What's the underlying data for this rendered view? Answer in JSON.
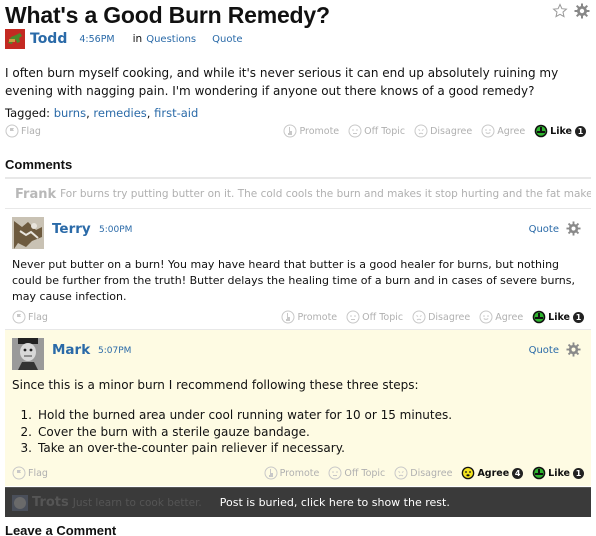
{
  "question": {
    "title": "What's a Good Burn Remedy?",
    "author": "Todd",
    "time": "4:56PM",
    "in_label": "in",
    "category": "Questions",
    "quote_label": "Quote",
    "body": "I often burn myself cooking, and while it's never serious it can end up absolutely ruining my evening with nagging pain. I'm wondering if anyone out there knows of a good remedy?",
    "tagged_label": "Tagged:",
    "tags": [
      "burns",
      "remedies",
      "first-aid"
    ],
    "actions": {
      "flag": "Flag",
      "promote": "Promote",
      "off_topic": "Off Topic",
      "disagree": "Disagree",
      "agree": "Agree",
      "like": "Like",
      "like_count": "1"
    }
  },
  "comments_title": "Comments",
  "collapsed_comment": {
    "author": "Frank",
    "snippet": "For burns try putting butter on it. The cold cools the burn and makes it stop hurting and the fat makes it he..."
  },
  "comments": [
    {
      "author": "Terry",
      "time": "5:00PM",
      "quote_label": "Quote",
      "body": "Never put butter on a burn! You may have heard that butter is a good healer for burns, but nothing could be further from the truth! Butter delays the healing time of a burn and in cases of severe burns, may cause infection.",
      "actions": {
        "flag": "Flag",
        "promote": "Promote",
        "off_topic": "Off Topic",
        "disagree": "Disagree",
        "agree": "Agree",
        "like": "Like",
        "like_count": "1"
      }
    },
    {
      "author": "Mark",
      "time": "5:07PM",
      "quote_label": "Quote",
      "body": "Since this is a minor burn I recommend following these three steps:",
      "steps": [
        {
          "num": "1.",
          "text": "Hold the burned area under cool running water for 10 or 15 minutes."
        },
        {
          "num": "2.",
          "text": "Cover the burn with a sterile gauze bandage."
        },
        {
          "num": "3.",
          "text": "Take an over-the-counter pain reliever if necessary."
        }
      ],
      "actions": {
        "flag": "Flag",
        "promote": "Promote",
        "off_topic": "Off Topic",
        "disagree": "Disagree",
        "agree": "Agree",
        "agree_count": "4",
        "like": "Like",
        "like_count": "1"
      }
    }
  ],
  "buried_comment": {
    "author": "Trots",
    "snippet": "Just learn to cook better.",
    "message": "Post is buried, click here to show the rest."
  },
  "leave_comment_title": "Leave a Comment",
  "colors": {
    "link": "#2a6aa8",
    "highlight_bg": "#fefbe3",
    "buried_bg": "#3a3a3a",
    "like_green": "#2fb52f",
    "agree_yellow": "#f2e21e"
  }
}
